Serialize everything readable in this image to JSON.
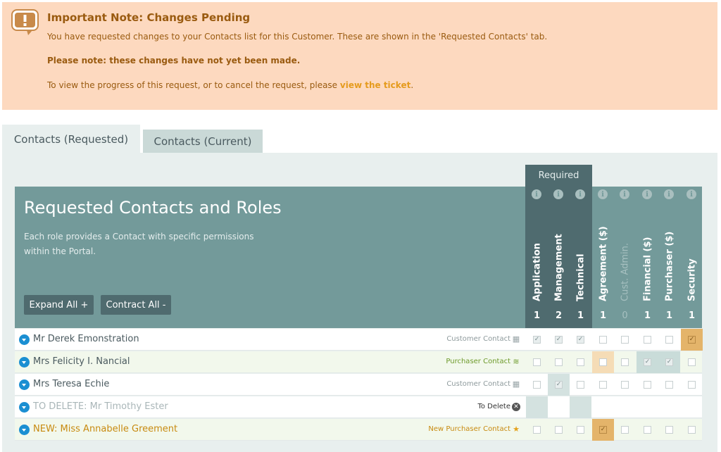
{
  "notice": {
    "title": "Important Note: Changes Pending",
    "line1": "You have requested changes to your Contacts list for this Customer. These are shown in the 'Requested Contacts' tab.",
    "line2": "Please note: these changes have not yet been made.",
    "line3_prefix": "To view the progress of this request, or to cancel the request, please ",
    "line3_link": "view the ticket",
    "line3_suffix": "."
  },
  "tabs": [
    {
      "label": "Contacts (Requested)",
      "active": true
    },
    {
      "label": "Contacts (Current)",
      "active": false
    }
  ],
  "panel": {
    "required_label": "Required",
    "title": "Requested Contacts and Roles",
    "description": "Each role provides a Contact with specific permissions within the Portal.",
    "expand_label": "Expand All +",
    "contract_label": "Contract All -",
    "info_glyph": "i"
  },
  "columns": [
    {
      "label": "Application",
      "count": "1",
      "required": true,
      "dim": false
    },
    {
      "label": "Management",
      "count": "2",
      "required": true,
      "dim": false
    },
    {
      "label": "Technical",
      "count": "1",
      "required": true,
      "dim": false
    },
    {
      "label": "Agreement ($)",
      "count": "1",
      "required": false,
      "dim": false
    },
    {
      "label": "Cust. Admin.",
      "count": "0",
      "required": false,
      "dim": true
    },
    {
      "label": "Financial ($)",
      "count": "1",
      "required": false,
      "dim": false
    },
    {
      "label": "Purchaser ($)",
      "count": "1",
      "required": false,
      "dim": false
    },
    {
      "label": "Security",
      "count": "1",
      "required": false,
      "dim": false
    }
  ],
  "rows": [
    {
      "name": "Mr Derek Emonstration",
      "type": "Customer Contact",
      "type_icon": "building-icon",
      "checks": [
        1,
        1,
        1,
        0,
        0,
        0,
        0,
        1
      ]
    },
    {
      "name": "Mrs Felicity I. Nancial",
      "type": "Purchaser Contact",
      "type_icon": "coins-icon",
      "checks": [
        0,
        0,
        0,
        0,
        0,
        1,
        1,
        0
      ]
    },
    {
      "name": "Mrs Teresa Echie",
      "type": "Customer Contact",
      "type_icon": "building-icon",
      "checks": [
        0,
        1,
        0,
        0,
        0,
        0,
        0,
        0
      ]
    },
    {
      "name": "TO DELETE: Mr Timothy Ester",
      "type": "To Delete",
      "type_icon": "close-circle-icon",
      "checks": []
    },
    {
      "name": "NEW: Miss Annabelle Greement",
      "type": "New Purchaser Contact",
      "type_icon": "star-icon",
      "checks": [
        0,
        0,
        0,
        1,
        0,
        0,
        0,
        0
      ]
    }
  ],
  "colors": {
    "banner_bg": "#fdd9bf",
    "banner_text": "#9a5b10",
    "link": "#e59b1d",
    "header_teal": "#739a9a",
    "required_dark": "#4f6b6f",
    "expand_blue": "#1b8fd2",
    "highlight_orange": "#e4b46a"
  }
}
